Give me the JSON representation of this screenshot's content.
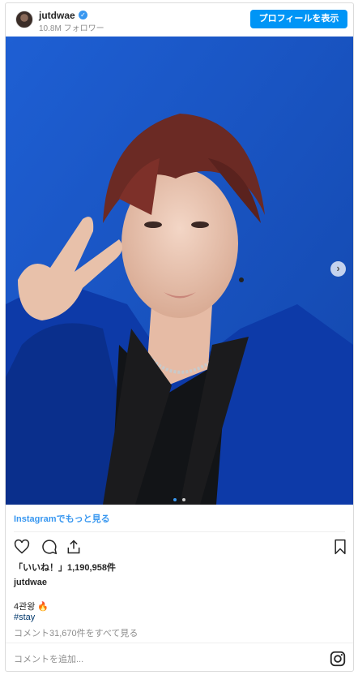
{
  "header": {
    "username": "jutdwae",
    "verified_mark": "✓",
    "followers": "10.8M フォロワー",
    "profile_button": "プロフィールを表示"
  },
  "photo": {
    "next_arrow": "›",
    "slides_total": 2,
    "slide_current": 1,
    "background_color": "#1c58c8"
  },
  "links": {
    "view_more": "Instagramでもっと見る"
  },
  "actions": {
    "icons": [
      "heart-icon",
      "comment-icon",
      "share-icon",
      "bookmark-icon"
    ]
  },
  "post": {
    "likes": "「いいね！」1,190,958件",
    "author": "jutdwae",
    "caption": "4관왕 🔥",
    "hashtag": "#stay",
    "view_comments": "コメント31,670件をすべて見る"
  },
  "footer": {
    "comment_placeholder": "コメントを追加...",
    "instagram_icon": "instagram-icon"
  },
  "colors": {
    "accent": "#0095f6",
    "link": "#3897f0",
    "hashtag": "#00376b",
    "muted": "#8e8e8e"
  }
}
